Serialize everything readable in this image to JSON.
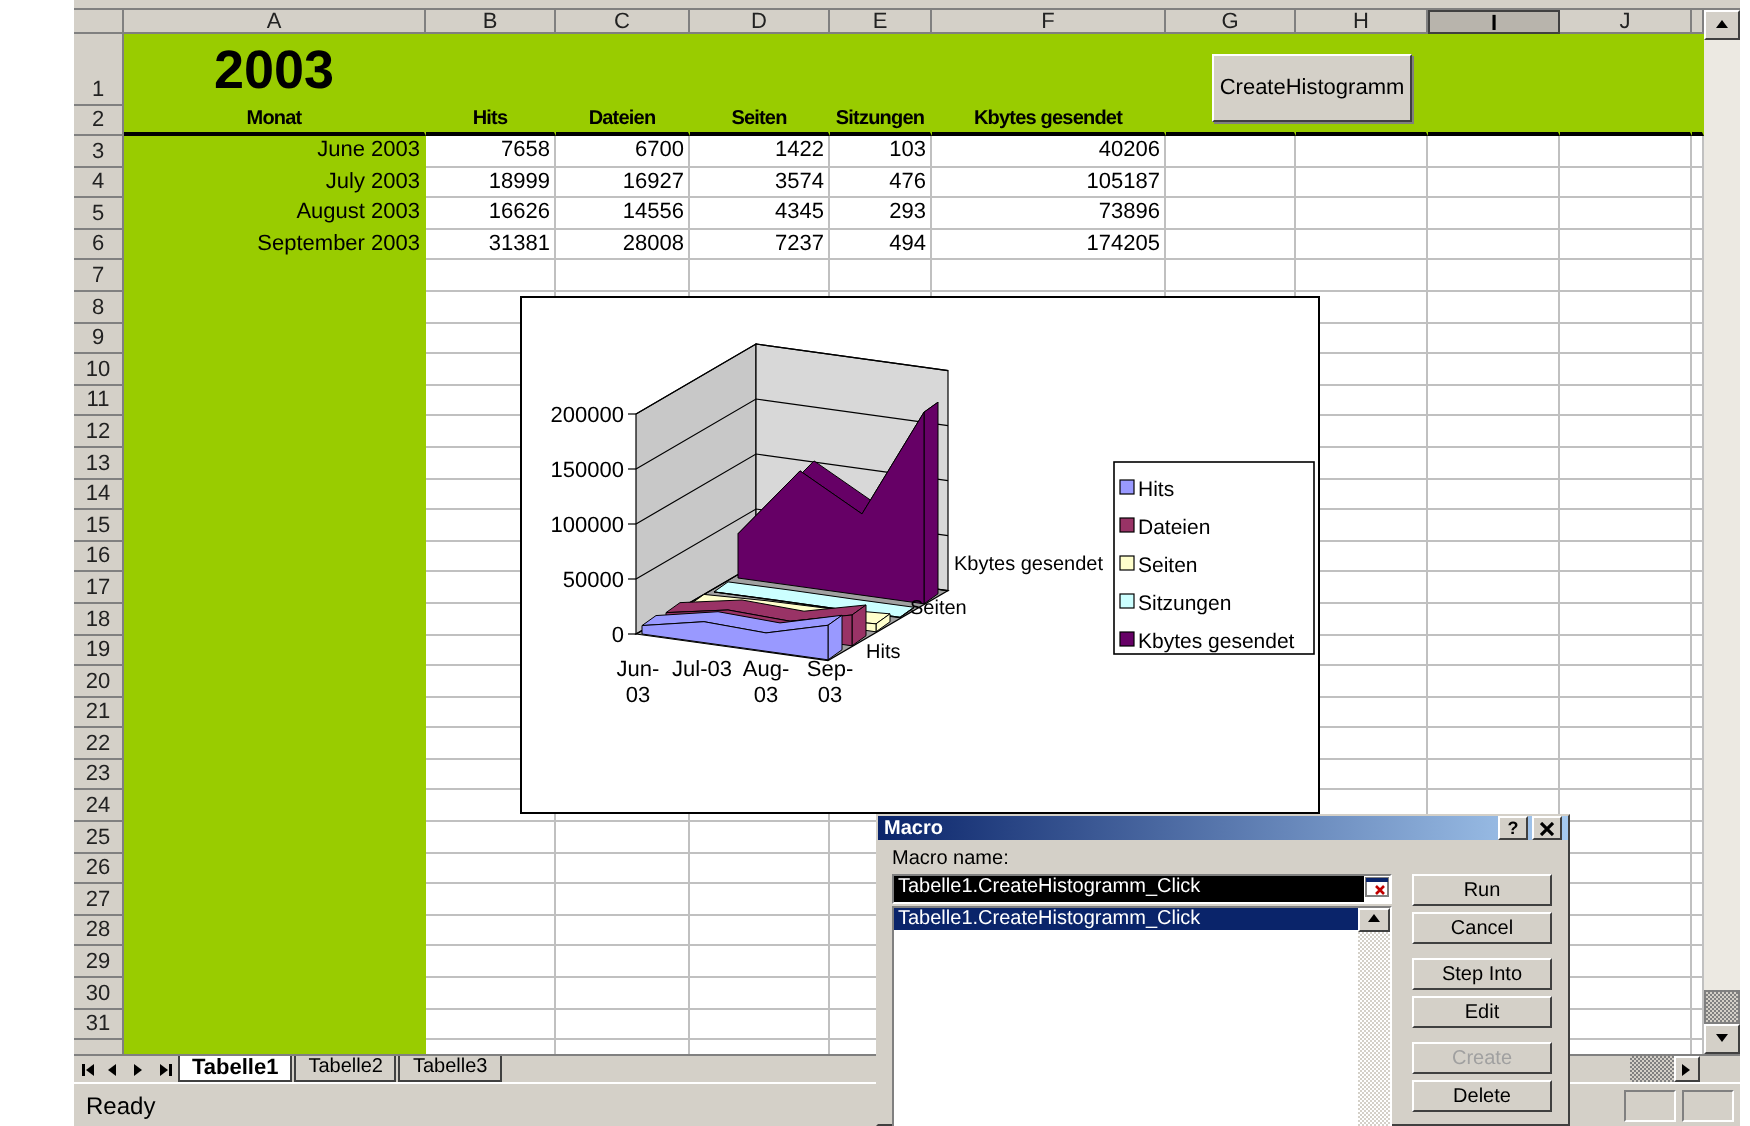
{
  "sheet": {
    "columns": [
      {
        "label": "A",
        "selected": false
      },
      {
        "label": "B",
        "selected": false
      },
      {
        "label": "C",
        "selected": false
      },
      {
        "label": "D",
        "selected": false
      },
      {
        "label": "E",
        "selected": false
      },
      {
        "label": "F",
        "selected": false
      },
      {
        "label": "G",
        "selected": false
      },
      {
        "label": "H",
        "selected": false
      },
      {
        "label": "I",
        "selected": true
      },
      {
        "label": "J",
        "selected": false
      }
    ],
    "row_numbers": [
      "1",
      "2",
      "3",
      "4",
      "5",
      "6",
      "7",
      "8",
      "9",
      "10",
      "11",
      "12",
      "13",
      "14",
      "15",
      "16",
      "17",
      "18",
      "19",
      "20",
      "21",
      "22",
      "23",
      "24",
      "25",
      "26",
      "27",
      "28",
      "29",
      "30",
      "31"
    ],
    "title": "2003",
    "header": [
      "Monat",
      "Hits",
      "Dateien",
      "Seiten",
      "Sitzungen",
      "Kbytes gesendet"
    ],
    "data": [
      [
        "June 2003",
        "7658",
        "6700",
        "1422",
        "103",
        "40206"
      ],
      [
        "July 2003",
        "18999",
        "16927",
        "3574",
        "476",
        "105187"
      ],
      [
        "August 2003",
        "16626",
        "14556",
        "4345",
        "293",
        "73896"
      ],
      [
        "September 2003",
        "31381",
        "28008",
        "7237",
        "494",
        "174205"
      ]
    ]
  },
  "macro_button": {
    "label": "CreateHistogramm"
  },
  "chart": {
    "y_axis_labels": [
      "200000",
      "150000",
      "100000",
      "50000",
      "0"
    ],
    "categories": [
      "Jun-03",
      "Jul-03",
      "Aug-03",
      "Sep-03"
    ],
    "depth_labels": [
      "Hits",
      "Seiten",
      "Kbytes gesendet"
    ],
    "legend": [
      {
        "name": "Hits",
        "color": "#9999ff"
      },
      {
        "name": "Dateien",
        "color": "#993366"
      },
      {
        "name": "Seiten",
        "color": "#ffffcc"
      },
      {
        "name": "Sitzungen",
        "color": "#ccffff"
      },
      {
        "name": "Kbytes gesendet",
        "color": "#660066"
      }
    ]
  },
  "dialog": {
    "title": "Macro",
    "help": "?",
    "macro_name_label": "Macro name:",
    "macro_name": "Tabelle1.CreateHistogramm_Click",
    "macros": [
      {
        "name": "Tabelle1.CreateHistogramm_Click",
        "selected": true
      }
    ],
    "buttons": [
      {
        "label": "Run",
        "disabled": false
      },
      {
        "label": "Cancel",
        "disabled": false
      },
      {
        "label": "Step Into",
        "disabled": false
      },
      {
        "label": "Edit",
        "disabled": false
      },
      {
        "label": "Create",
        "disabled": true
      },
      {
        "label": "Delete",
        "disabled": false
      }
    ]
  },
  "sheet_tabs": [
    {
      "label": "Tabelle1",
      "selected": true
    },
    {
      "label": "Tabelle2",
      "selected": false
    },
    {
      "label": "Tabelle3",
      "selected": false
    }
  ],
  "status_bar": {
    "text": "Ready"
  }
}
